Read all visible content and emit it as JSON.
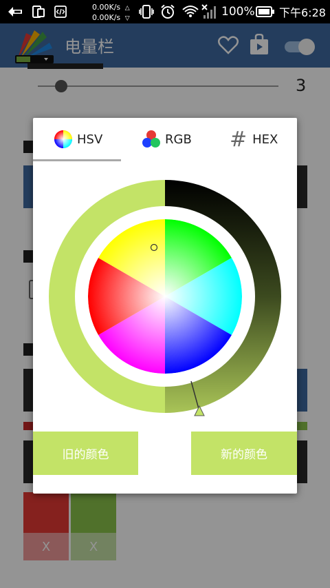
{
  "status_bar": {
    "net_up": "0.00K/s",
    "net_down": "0.00K/s",
    "battery": "100%",
    "time": "下午6:28"
  },
  "app_bar": {
    "title": "电量栏",
    "icons": [
      "heart-outline-icon",
      "shopping-bag-icon",
      "toggle-switch-icon"
    ]
  },
  "background": {
    "slider_value": "3",
    "colors": {
      "blue": "#3f6aa0",
      "dark": "#2a2a2a",
      "red": "#c62828",
      "green": "#7cb342",
      "lime": "#8bc34a"
    },
    "swatch_delete_1": "X",
    "swatch_delete_2": "X"
  },
  "dialog": {
    "tabs": [
      {
        "label": "HSV",
        "icon": "hsv-wheel-icon",
        "selected": true
      },
      {
        "label": "RGB",
        "icon": "rgb-circles-icon",
        "selected": false
      },
      {
        "label": "HEX",
        "icon": "hash-icon",
        "hash": "#",
        "selected": false
      }
    ],
    "selected_color": "#c3e367",
    "buttons": {
      "old_color": "旧的颜色",
      "new_color": "新的颜色"
    }
  }
}
